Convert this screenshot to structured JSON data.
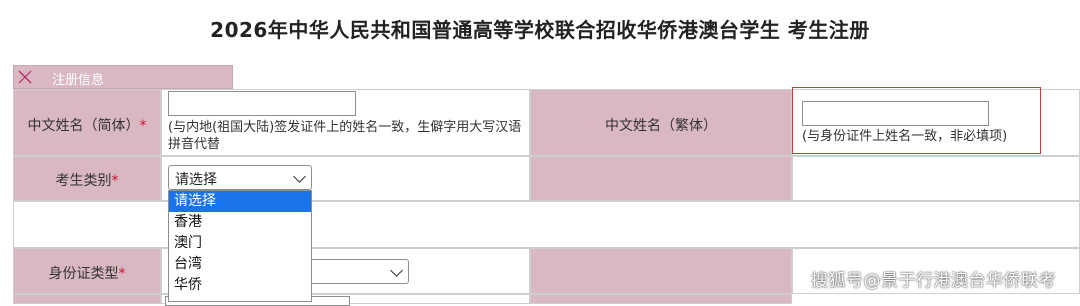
{
  "page_title": "2026年中华人民共和国普通高等学校联合招收华侨港澳台学生  考生注册",
  "section": {
    "label": "注册信息"
  },
  "fields": {
    "name_simplified": {
      "label": "中文姓名（简体）",
      "required_mark": "*",
      "value": "",
      "hint": "(与内地(祖国大陆)签发证件上的姓名一致，生僻字用大写汉语拼音代替"
    },
    "name_traditional": {
      "label": "中文姓名（繁体）",
      "value": "",
      "hint": "(与身份证件上姓名一致，非必填项)"
    },
    "candidate_type": {
      "label": "考生类别",
      "required_mark": "*",
      "selected": "请选择",
      "options": [
        "请选择",
        "香港",
        "澳门",
        "台湾",
        "华侨"
      ]
    },
    "id_type": {
      "label": "身份证类型",
      "required_mark": "*",
      "selected": ""
    }
  },
  "watermark": "搜狐号@景于行港澳台华侨联考",
  "colors": {
    "label_bg": "#d9b8c1",
    "highlight_border": "#e0303a",
    "dropdown_selected": "#1a73e8"
  }
}
